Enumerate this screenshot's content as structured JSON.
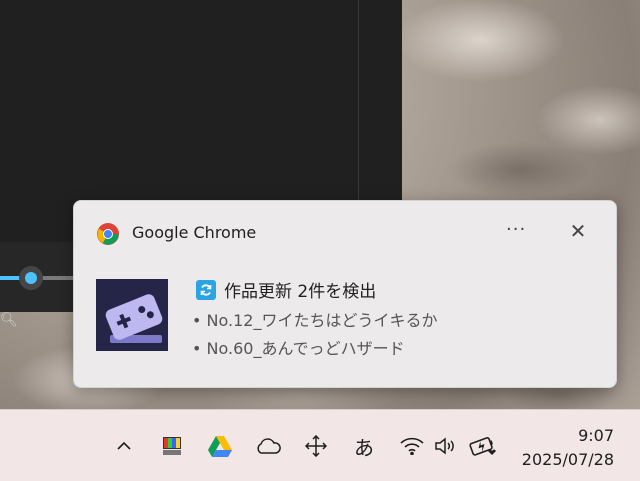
{
  "notification": {
    "app_name": "Google Chrome",
    "more_label": "···",
    "close_label": "✕",
    "title": "作品更新 2件を検出",
    "lines": [
      "• No.12_ワイたちはどうイキるか",
      "• No.60_あんでっどハザード"
    ]
  },
  "taskbar": {
    "chevron_label": "^",
    "ime_label": "あ",
    "time": "9:07",
    "date": "2025/07/28"
  },
  "colors": {
    "accent_blue": "#4cc2ff",
    "toast_bg": "#eceaea",
    "taskbar_bg": "#f2e6e6"
  }
}
